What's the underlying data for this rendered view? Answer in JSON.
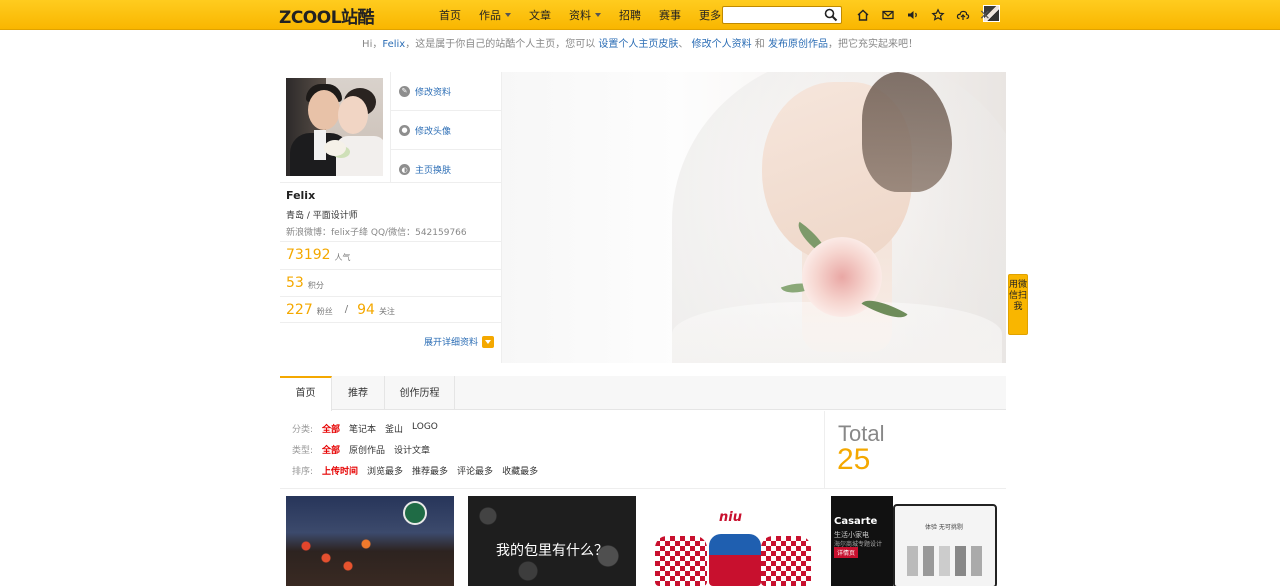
{
  "brand": {
    "logo": "ZCOOL站酷"
  },
  "nav": {
    "items": [
      {
        "label": "首页",
        "dropdown": false
      },
      {
        "label": "作品",
        "dropdown": true
      },
      {
        "label": "文章",
        "dropdown": false
      },
      {
        "label": "资料",
        "dropdown": true
      },
      {
        "label": "招聘",
        "dropdown": false
      },
      {
        "label": "赛事",
        "dropdown": false
      },
      {
        "label": "更多",
        "dropdown": true
      }
    ],
    "search": {
      "value": "",
      "placeholder": "",
      "icon": "search-icon"
    },
    "icons": [
      "home-icon",
      "mail-icon",
      "sound-icon",
      "star-icon",
      "upload-icon"
    ]
  },
  "notice": {
    "pre": "Hi，",
    "name": "Felix",
    "mid": "，这是属于你自己的站酷个人主页，您可以",
    "link1": "设置个人主页皮肤",
    "sep1": "、",
    "link2": "修改个人资料",
    "and": "和",
    "link3": "发布原创作品",
    "post": "，把它充实起来吧！",
    "close": "×"
  },
  "profile": {
    "actions": [
      {
        "label": "修改资料",
        "icon": "edit-icon"
      },
      {
        "label": "修改头像",
        "icon": "user-icon"
      },
      {
        "label": "主页换肤",
        "icon": "skin-icon"
      }
    ],
    "username": "Felix",
    "role": "青岛 / 平面设计师",
    "weibo": "新浪微博：felix子绛 QQ/微信：542159766",
    "popularity": {
      "value": "73192",
      "label": "人气"
    },
    "points": {
      "value": "53",
      "label": "积分"
    },
    "fans": {
      "value": "227",
      "label": "粉丝"
    },
    "separator": "/",
    "following": {
      "value": "94",
      "label": "关注"
    },
    "expand_label": "展开详细资料"
  },
  "wechat_tab": "用微信扫我",
  "tabs": [
    {
      "label": "首页",
      "active": true
    },
    {
      "label": "推荐",
      "active": false
    },
    {
      "label": "创作历程",
      "active": false
    }
  ],
  "filters": {
    "category": {
      "label": "分类:",
      "options": [
        "全部",
        "笔记本",
        "釜山",
        "LOGO"
      ]
    },
    "type": {
      "label": "类型:",
      "options": [
        "全部",
        "原创作品",
        "设计文章"
      ]
    },
    "sort": {
      "label": "排序:",
      "options": [
        "上传时间",
        "浏览最多",
        "推荐最多",
        "评论最多",
        "收藏最多"
      ]
    }
  },
  "total": {
    "label": "Total",
    "value": "25"
  },
  "thumbnails": {
    "t2_text": "我的包里有什么？",
    "t3_brand": "niu",
    "t4_brand": "Casarte",
    "t4_sub1": "生活小家电",
    "t4_sub2": "海尔商城专题设计",
    "t4_btn": "详情页",
    "t4_screen": "体验 无可挑剔"
  },
  "colors": {
    "accent": "#f4a800",
    "topbar": "#ffcc1f",
    "link": "#2b6db5",
    "active_filter": "#e60000"
  }
}
